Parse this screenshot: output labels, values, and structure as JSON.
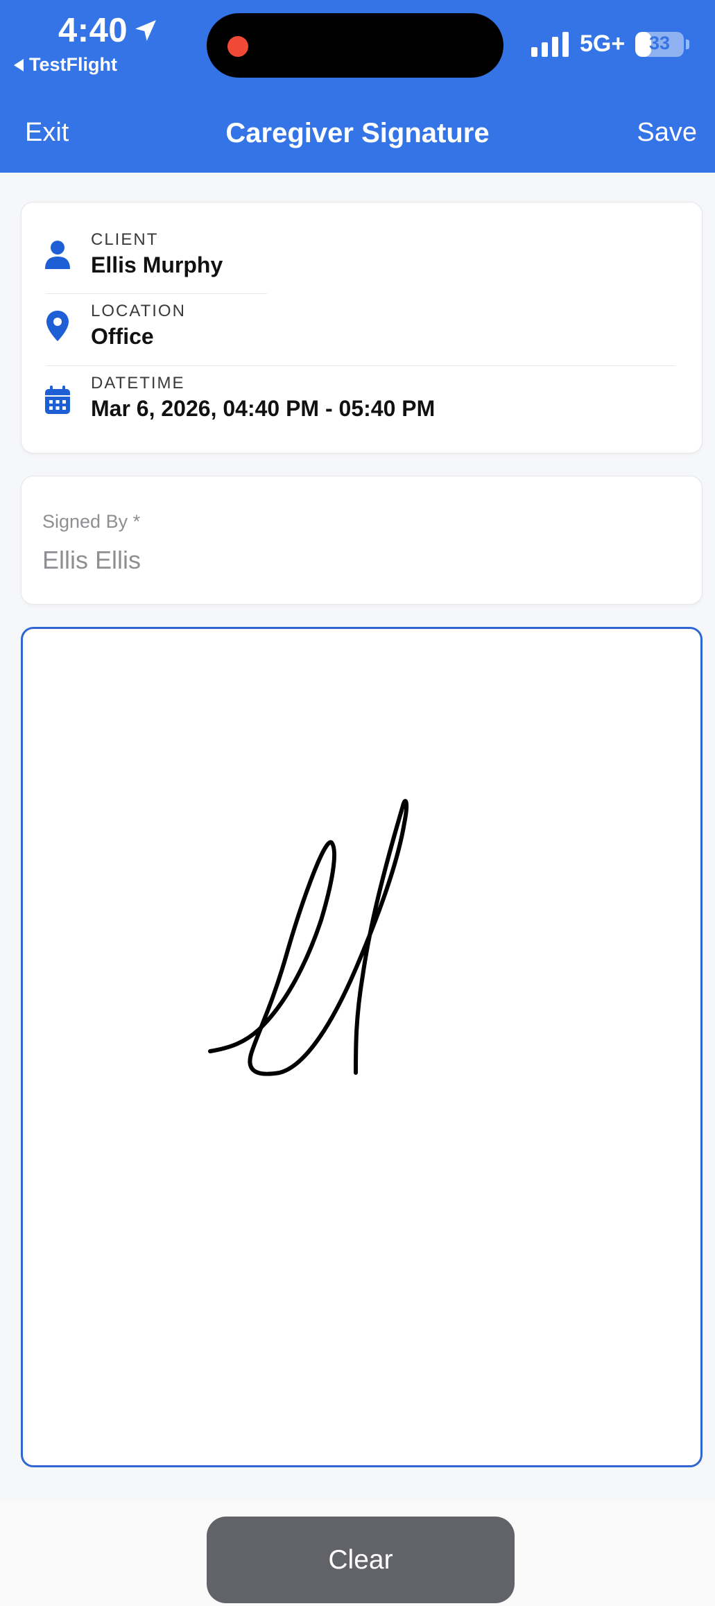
{
  "status_bar": {
    "time": "4:40",
    "back_app": "TestFlight",
    "network": "5G+",
    "battery_level": 33,
    "battery_text": "33"
  },
  "nav": {
    "exit_label": "Exit",
    "title": "Caregiver Signature",
    "save_label": "Save"
  },
  "info": {
    "client_label": "CLIENT",
    "client_value": "Ellis Murphy",
    "location_label": "LOCATION",
    "location_value": "Office",
    "datetime_label": "DATETIME",
    "datetime_value": "Mar 6, 2026, 04:40 PM - 05:40 PM"
  },
  "signed_by": {
    "label": "Signed By *",
    "value": "Ellis Ellis"
  },
  "actions": {
    "clear_label": "Clear"
  },
  "colors": {
    "header_blue": "#3574e6",
    "icon_blue": "#1f5fd6",
    "pad_border": "#2f66cf",
    "clear_button": "#616369"
  }
}
